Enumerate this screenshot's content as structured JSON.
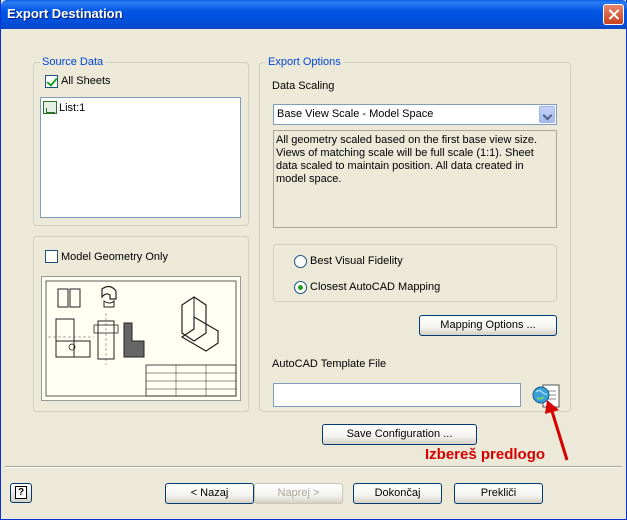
{
  "window": {
    "title": "Export Destination"
  },
  "source_data": {
    "legend": "Source Data",
    "all_sheets_label": "All Sheets",
    "all_sheets_checked": true,
    "sheets": [
      "List:1"
    ]
  },
  "geometry": {
    "model_geometry_only_label": "Model Geometry Only",
    "model_geometry_only_checked": false
  },
  "export_options": {
    "legend": "Export Options",
    "data_scaling_label": "Data Scaling",
    "data_scaling_value": "Base View Scale - Model Space",
    "description": "All geometry scaled based on the first base view size. Views of matching scale will be full scale (1:1). Sheet data scaled to maintain position. All data created in model space.",
    "radio_best_visual": "Best Visual Fidelity",
    "radio_closest_mapping": "Closest AutoCAD Mapping",
    "selected_radio": "Closest AutoCAD Mapping",
    "mapping_options_button": "Mapping Options ...",
    "template_file_label": "AutoCAD Template File",
    "template_file_value": ""
  },
  "save_configuration_button": "Save Configuration ...",
  "annotation": {
    "text": "Izbereš predlogo",
    "color": "#d60000"
  },
  "footer": {
    "help_icon": "?",
    "back_button": "< Nazaj",
    "next_button": "Naprej >",
    "finish_button": "Dokončaj",
    "cancel_button": "Prekliči"
  },
  "colors": {
    "title_bar": "#0054e3",
    "dialog_bg": "#ece9d8",
    "legend_text": "#0046d5",
    "annotation": "#d60000"
  }
}
